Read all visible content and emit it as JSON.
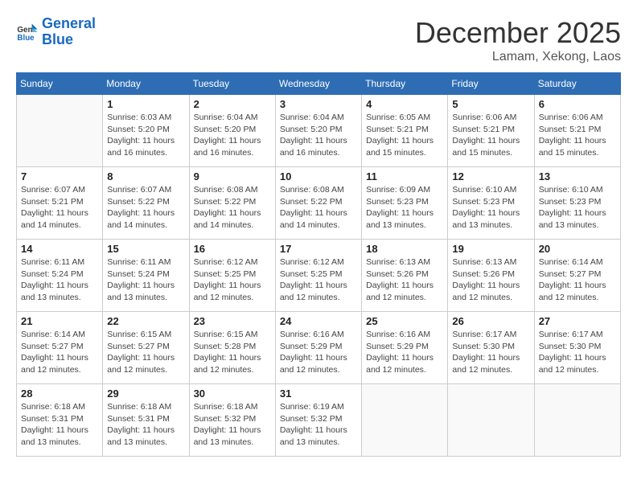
{
  "logo": {
    "line1": "General",
    "line2": "Blue"
  },
  "title": "December 2025",
  "location": "Lamam, Xekong, Laos",
  "days_of_week": [
    "Sunday",
    "Monday",
    "Tuesday",
    "Wednesday",
    "Thursday",
    "Friday",
    "Saturday"
  ],
  "weeks": [
    [
      {
        "day": "",
        "info": ""
      },
      {
        "day": "1",
        "info": "Sunrise: 6:03 AM\nSunset: 5:20 PM\nDaylight: 11 hours\nand 16 minutes."
      },
      {
        "day": "2",
        "info": "Sunrise: 6:04 AM\nSunset: 5:20 PM\nDaylight: 11 hours\nand 16 minutes."
      },
      {
        "day": "3",
        "info": "Sunrise: 6:04 AM\nSunset: 5:20 PM\nDaylight: 11 hours\nand 16 minutes."
      },
      {
        "day": "4",
        "info": "Sunrise: 6:05 AM\nSunset: 5:21 PM\nDaylight: 11 hours\nand 15 minutes."
      },
      {
        "day": "5",
        "info": "Sunrise: 6:06 AM\nSunset: 5:21 PM\nDaylight: 11 hours\nand 15 minutes."
      },
      {
        "day": "6",
        "info": "Sunrise: 6:06 AM\nSunset: 5:21 PM\nDaylight: 11 hours\nand 15 minutes."
      }
    ],
    [
      {
        "day": "7",
        "info": "Sunrise: 6:07 AM\nSunset: 5:21 PM\nDaylight: 11 hours\nand 14 minutes."
      },
      {
        "day": "8",
        "info": "Sunrise: 6:07 AM\nSunset: 5:22 PM\nDaylight: 11 hours\nand 14 minutes."
      },
      {
        "day": "9",
        "info": "Sunrise: 6:08 AM\nSunset: 5:22 PM\nDaylight: 11 hours\nand 14 minutes."
      },
      {
        "day": "10",
        "info": "Sunrise: 6:08 AM\nSunset: 5:22 PM\nDaylight: 11 hours\nand 14 minutes."
      },
      {
        "day": "11",
        "info": "Sunrise: 6:09 AM\nSunset: 5:23 PM\nDaylight: 11 hours\nand 13 minutes."
      },
      {
        "day": "12",
        "info": "Sunrise: 6:10 AM\nSunset: 5:23 PM\nDaylight: 11 hours\nand 13 minutes."
      },
      {
        "day": "13",
        "info": "Sunrise: 6:10 AM\nSunset: 5:23 PM\nDaylight: 11 hours\nand 13 minutes."
      }
    ],
    [
      {
        "day": "14",
        "info": "Sunrise: 6:11 AM\nSunset: 5:24 PM\nDaylight: 11 hours\nand 13 minutes."
      },
      {
        "day": "15",
        "info": "Sunrise: 6:11 AM\nSunset: 5:24 PM\nDaylight: 11 hours\nand 13 minutes."
      },
      {
        "day": "16",
        "info": "Sunrise: 6:12 AM\nSunset: 5:25 PM\nDaylight: 11 hours\nand 12 minutes."
      },
      {
        "day": "17",
        "info": "Sunrise: 6:12 AM\nSunset: 5:25 PM\nDaylight: 11 hours\nand 12 minutes."
      },
      {
        "day": "18",
        "info": "Sunrise: 6:13 AM\nSunset: 5:26 PM\nDaylight: 11 hours\nand 12 minutes."
      },
      {
        "day": "19",
        "info": "Sunrise: 6:13 AM\nSunset: 5:26 PM\nDaylight: 11 hours\nand 12 minutes."
      },
      {
        "day": "20",
        "info": "Sunrise: 6:14 AM\nSunset: 5:27 PM\nDaylight: 11 hours\nand 12 minutes."
      }
    ],
    [
      {
        "day": "21",
        "info": "Sunrise: 6:14 AM\nSunset: 5:27 PM\nDaylight: 11 hours\nand 12 minutes."
      },
      {
        "day": "22",
        "info": "Sunrise: 6:15 AM\nSunset: 5:27 PM\nDaylight: 11 hours\nand 12 minutes."
      },
      {
        "day": "23",
        "info": "Sunrise: 6:15 AM\nSunset: 5:28 PM\nDaylight: 11 hours\nand 12 minutes."
      },
      {
        "day": "24",
        "info": "Sunrise: 6:16 AM\nSunset: 5:29 PM\nDaylight: 11 hours\nand 12 minutes."
      },
      {
        "day": "25",
        "info": "Sunrise: 6:16 AM\nSunset: 5:29 PM\nDaylight: 11 hours\nand 12 minutes."
      },
      {
        "day": "26",
        "info": "Sunrise: 6:17 AM\nSunset: 5:30 PM\nDaylight: 11 hours\nand 12 minutes."
      },
      {
        "day": "27",
        "info": "Sunrise: 6:17 AM\nSunset: 5:30 PM\nDaylight: 11 hours\nand 12 minutes."
      }
    ],
    [
      {
        "day": "28",
        "info": "Sunrise: 6:18 AM\nSunset: 5:31 PM\nDaylight: 11 hours\nand 13 minutes."
      },
      {
        "day": "29",
        "info": "Sunrise: 6:18 AM\nSunset: 5:31 PM\nDaylight: 11 hours\nand 13 minutes."
      },
      {
        "day": "30",
        "info": "Sunrise: 6:18 AM\nSunset: 5:32 PM\nDaylight: 11 hours\nand 13 minutes."
      },
      {
        "day": "31",
        "info": "Sunrise: 6:19 AM\nSunset: 5:32 PM\nDaylight: 11 hours\nand 13 minutes."
      },
      {
        "day": "",
        "info": ""
      },
      {
        "day": "",
        "info": ""
      },
      {
        "day": "",
        "info": ""
      }
    ]
  ]
}
